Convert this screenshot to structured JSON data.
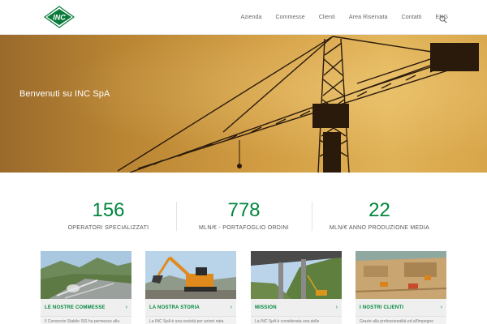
{
  "logo_text": "INC",
  "colors": {
    "brand_green": "#00873d",
    "hero_orange": "#d29d43",
    "nav_text": "#666666"
  },
  "nav": {
    "items": [
      "Azienda",
      "Commesse",
      "Clienti",
      "Area Riservata",
      "Contatti",
      "ENG"
    ],
    "search_icon": "search-icon"
  },
  "hero": {
    "title": "Benvenuti su INC SpA"
  },
  "stats": [
    {
      "value": "156",
      "label": "OPERATORI SPECIALIZZATI"
    },
    {
      "value": "778",
      "label": "MLN/€ - PORTAFOGLIO ORDINI"
    },
    {
      "value": "22",
      "label": "MLN/€ ANNO PRODUZIONE MEDIA"
    }
  ],
  "cards": [
    {
      "title": "LE NOSTRE COMMESSE",
      "text": "Il Consorzio Stabile SIS ha permesso alla"
    },
    {
      "title": "LA NOSTRA STORIA",
      "text": "La INC SpA è una società per azioni nata"
    },
    {
      "title": "MISSION",
      "text": "La INC SpA è considerata una delle"
    },
    {
      "title": "I NOSTRI CLIENTI",
      "text": "Grazie alla professionalità ed all'impegno"
    }
  ]
}
